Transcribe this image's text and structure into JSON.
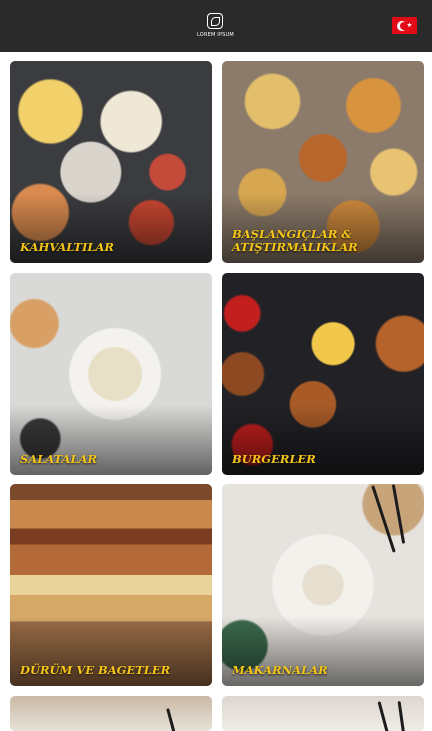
{
  "header": {
    "logo_text": "LOREM IPSUM",
    "language_flag": "turkish-flag-icon",
    "background_color": "#2a2a2a"
  },
  "categories": [
    {
      "title": "KAHVALTILAR"
    },
    {
      "title": "BAŞLANGIÇLAR & ATIŞTIRMALIKLAR"
    },
    {
      "title": "SALATALAR"
    },
    {
      "title": "BURGERLER"
    },
    {
      "title": "DÜRÜM VE BAGETLER"
    },
    {
      "title": "MAKARNALAR"
    }
  ],
  "theme": {
    "title_color": "#f5c518",
    "page_background": "#ffffff"
  }
}
